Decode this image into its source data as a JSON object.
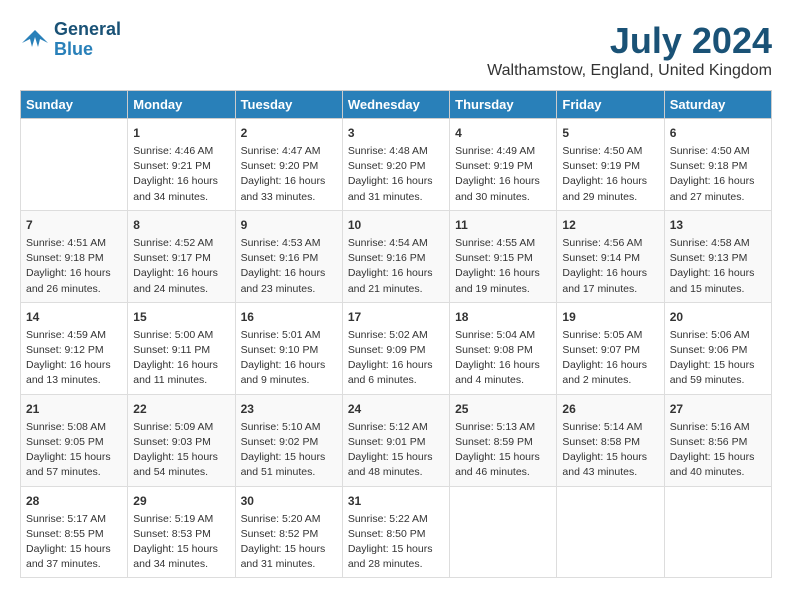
{
  "header": {
    "logo_line1": "General",
    "logo_line2": "Blue",
    "title": "July 2024",
    "subtitle": "Walthamstow, England, United Kingdom"
  },
  "days_of_week": [
    "Sunday",
    "Monday",
    "Tuesday",
    "Wednesday",
    "Thursday",
    "Friday",
    "Saturday"
  ],
  "weeks": [
    [
      {
        "day": "",
        "info": ""
      },
      {
        "day": "1",
        "info": "Sunrise: 4:46 AM\nSunset: 9:21 PM\nDaylight: 16 hours\nand 34 minutes."
      },
      {
        "day": "2",
        "info": "Sunrise: 4:47 AM\nSunset: 9:20 PM\nDaylight: 16 hours\nand 33 minutes."
      },
      {
        "day": "3",
        "info": "Sunrise: 4:48 AM\nSunset: 9:20 PM\nDaylight: 16 hours\nand 31 minutes."
      },
      {
        "day": "4",
        "info": "Sunrise: 4:49 AM\nSunset: 9:19 PM\nDaylight: 16 hours\nand 30 minutes."
      },
      {
        "day": "5",
        "info": "Sunrise: 4:50 AM\nSunset: 9:19 PM\nDaylight: 16 hours\nand 29 minutes."
      },
      {
        "day": "6",
        "info": "Sunrise: 4:50 AM\nSunset: 9:18 PM\nDaylight: 16 hours\nand 27 minutes."
      }
    ],
    [
      {
        "day": "7",
        "info": "Sunrise: 4:51 AM\nSunset: 9:18 PM\nDaylight: 16 hours\nand 26 minutes."
      },
      {
        "day": "8",
        "info": "Sunrise: 4:52 AM\nSunset: 9:17 PM\nDaylight: 16 hours\nand 24 minutes."
      },
      {
        "day": "9",
        "info": "Sunrise: 4:53 AM\nSunset: 9:16 PM\nDaylight: 16 hours\nand 23 minutes."
      },
      {
        "day": "10",
        "info": "Sunrise: 4:54 AM\nSunset: 9:16 PM\nDaylight: 16 hours\nand 21 minutes."
      },
      {
        "day": "11",
        "info": "Sunrise: 4:55 AM\nSunset: 9:15 PM\nDaylight: 16 hours\nand 19 minutes."
      },
      {
        "day": "12",
        "info": "Sunrise: 4:56 AM\nSunset: 9:14 PM\nDaylight: 16 hours\nand 17 minutes."
      },
      {
        "day": "13",
        "info": "Sunrise: 4:58 AM\nSunset: 9:13 PM\nDaylight: 16 hours\nand 15 minutes."
      }
    ],
    [
      {
        "day": "14",
        "info": "Sunrise: 4:59 AM\nSunset: 9:12 PM\nDaylight: 16 hours\nand 13 minutes."
      },
      {
        "day": "15",
        "info": "Sunrise: 5:00 AM\nSunset: 9:11 PM\nDaylight: 16 hours\nand 11 minutes."
      },
      {
        "day": "16",
        "info": "Sunrise: 5:01 AM\nSunset: 9:10 PM\nDaylight: 16 hours\nand 9 minutes."
      },
      {
        "day": "17",
        "info": "Sunrise: 5:02 AM\nSunset: 9:09 PM\nDaylight: 16 hours\nand 6 minutes."
      },
      {
        "day": "18",
        "info": "Sunrise: 5:04 AM\nSunset: 9:08 PM\nDaylight: 16 hours\nand 4 minutes."
      },
      {
        "day": "19",
        "info": "Sunrise: 5:05 AM\nSunset: 9:07 PM\nDaylight: 16 hours\nand 2 minutes."
      },
      {
        "day": "20",
        "info": "Sunrise: 5:06 AM\nSunset: 9:06 PM\nDaylight: 15 hours\nand 59 minutes."
      }
    ],
    [
      {
        "day": "21",
        "info": "Sunrise: 5:08 AM\nSunset: 9:05 PM\nDaylight: 15 hours\nand 57 minutes."
      },
      {
        "day": "22",
        "info": "Sunrise: 5:09 AM\nSunset: 9:03 PM\nDaylight: 15 hours\nand 54 minutes."
      },
      {
        "day": "23",
        "info": "Sunrise: 5:10 AM\nSunset: 9:02 PM\nDaylight: 15 hours\nand 51 minutes."
      },
      {
        "day": "24",
        "info": "Sunrise: 5:12 AM\nSunset: 9:01 PM\nDaylight: 15 hours\nand 48 minutes."
      },
      {
        "day": "25",
        "info": "Sunrise: 5:13 AM\nSunset: 8:59 PM\nDaylight: 15 hours\nand 46 minutes."
      },
      {
        "day": "26",
        "info": "Sunrise: 5:14 AM\nSunset: 8:58 PM\nDaylight: 15 hours\nand 43 minutes."
      },
      {
        "day": "27",
        "info": "Sunrise: 5:16 AM\nSunset: 8:56 PM\nDaylight: 15 hours\nand 40 minutes."
      }
    ],
    [
      {
        "day": "28",
        "info": "Sunrise: 5:17 AM\nSunset: 8:55 PM\nDaylight: 15 hours\nand 37 minutes."
      },
      {
        "day": "29",
        "info": "Sunrise: 5:19 AM\nSunset: 8:53 PM\nDaylight: 15 hours\nand 34 minutes."
      },
      {
        "day": "30",
        "info": "Sunrise: 5:20 AM\nSunset: 8:52 PM\nDaylight: 15 hours\nand 31 minutes."
      },
      {
        "day": "31",
        "info": "Sunrise: 5:22 AM\nSunset: 8:50 PM\nDaylight: 15 hours\nand 28 minutes."
      },
      {
        "day": "",
        "info": ""
      },
      {
        "day": "",
        "info": ""
      },
      {
        "day": "",
        "info": ""
      }
    ]
  ]
}
